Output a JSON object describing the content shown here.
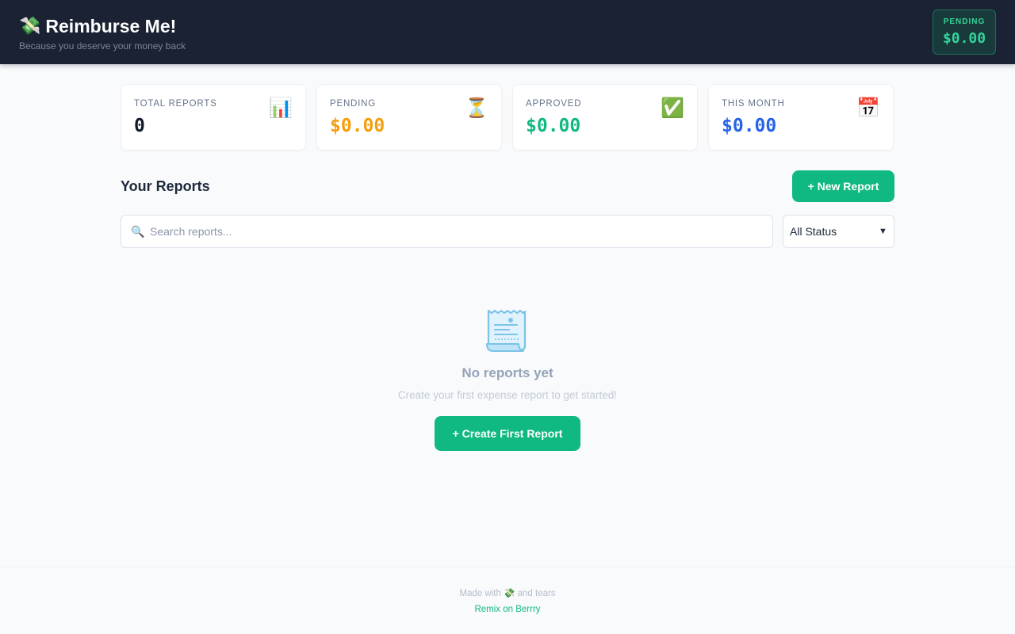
{
  "header": {
    "logo_emoji": "💸",
    "title": "Reimburse Me!",
    "tagline": "Because you deserve your money back",
    "pending_label": "PENDING",
    "pending_amount": "$0.00"
  },
  "stats": [
    {
      "label": "TOTAL REPORTS",
      "value": "0",
      "icon": "📊",
      "icon_name": "bar-chart-icon",
      "color": "#0f172a"
    },
    {
      "label": "PENDING",
      "value": "$0.00",
      "icon": "⏳",
      "icon_name": "hourglass-icon",
      "color": "#f59e0b"
    },
    {
      "label": "APPROVED",
      "value": "$0.00",
      "icon": "✅",
      "icon_name": "check-mark-icon",
      "color": "#10b981"
    },
    {
      "label": "THIS MONTH",
      "value": "$0.00",
      "icon": "📅",
      "icon_name": "calendar-icon",
      "color": "#2563eb"
    }
  ],
  "reports": {
    "title": "Your Reports",
    "new_button": "+ New Report",
    "search_placeholder": "Search reports...",
    "search_value": "",
    "status_selected": "All Status"
  },
  "empty_state": {
    "icon_name": "receipt-icon",
    "title": "No reports yet",
    "subtitle": "Create your first expense report to get started!",
    "button": "+ Create First Report"
  },
  "footer": {
    "made_prefix": "Made with",
    "made_emoji": "💸",
    "made_suffix": "and tears",
    "link": "Remix on Berrry"
  },
  "colors": {
    "accent": "#10b981",
    "header_bg": "#1a2233",
    "pending": "#f59e0b",
    "month": "#2563eb"
  }
}
